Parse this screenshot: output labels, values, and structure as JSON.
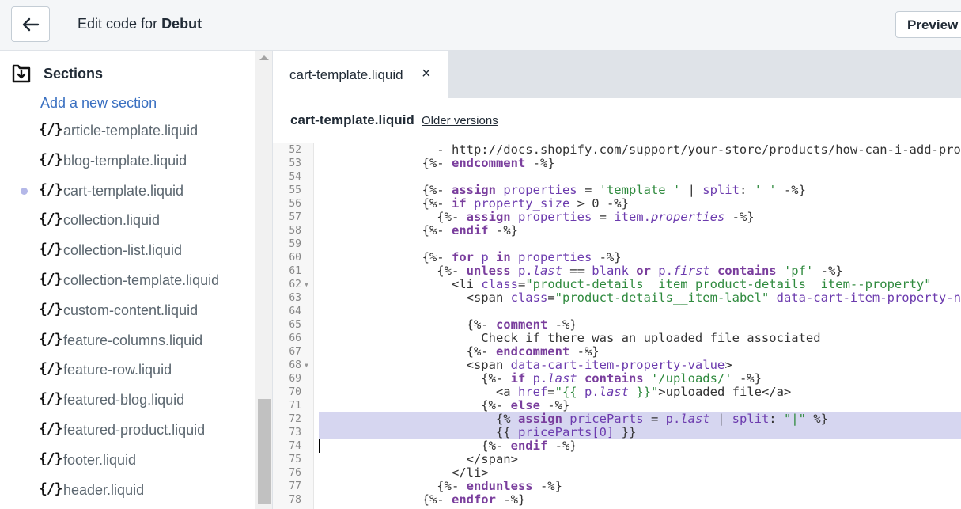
{
  "header": {
    "title_prefix": "Edit code for ",
    "theme_name": "Debut",
    "preview_label": "Preview"
  },
  "sidebar": {
    "section_title": "Sections",
    "add_link": "Add a new section",
    "active_index": 2,
    "files": [
      "article-template.liquid",
      "blog-template.liquid",
      "cart-template.liquid",
      "collection.liquid",
      "collection-list.liquid",
      "collection-template.liquid",
      "custom-content.liquid",
      "feature-columns.liquid",
      "feature-row.liquid",
      "featured-blog.liquid",
      "featured-product.liquid",
      "footer.liquid",
      "header.liquid"
    ],
    "file_icon_text": "{/}"
  },
  "editor": {
    "tab_label": "cart-template.liquid",
    "tab_close": "×",
    "file_name": "cart-template.liquid",
    "older_versions": "Older versions",
    "highlight_lines": [
      72,
      73
    ],
    "cursor_line": 74,
    "lines": [
      {
        "n": 52,
        "fold": false,
        "tokens": [
          [
            "p",
            "                - http://docs.shopify.com/support/your-store/products/how-can-i-add-product-options"
          ]
        ]
      },
      {
        "n": 53,
        "fold": false,
        "tokens": [
          [
            "p",
            "              {%- "
          ],
          [
            "k",
            "endcomment"
          ],
          [
            "p",
            " -%}"
          ]
        ]
      },
      {
        "n": 54,
        "fold": false,
        "tokens": [
          [
            "p",
            ""
          ]
        ]
      },
      {
        "n": 55,
        "fold": false,
        "tokens": [
          [
            "p",
            "              {%- "
          ],
          [
            "k",
            "assign"
          ],
          [
            "i",
            " properties"
          ],
          [
            "p",
            " = "
          ],
          [
            "s",
            "'template '"
          ],
          [
            "p",
            " | "
          ],
          [
            "i",
            "split"
          ],
          [
            "p",
            ": "
          ],
          [
            "s",
            "' '"
          ],
          [
            "p",
            " -%}"
          ]
        ]
      },
      {
        "n": 56,
        "fold": false,
        "tokens": [
          [
            "p",
            "              {%- "
          ],
          [
            "k",
            "if"
          ],
          [
            "i",
            " property_size"
          ],
          [
            "p",
            " > 0 -%}"
          ]
        ]
      },
      {
        "n": 57,
        "fold": false,
        "tokens": [
          [
            "p",
            "                {%- "
          ],
          [
            "k",
            "assign"
          ],
          [
            "i",
            " properties"
          ],
          [
            "p",
            " = "
          ],
          [
            "i",
            "item."
          ],
          [
            "e",
            "properties"
          ],
          [
            "p",
            " -%}"
          ]
        ]
      },
      {
        "n": 58,
        "fold": false,
        "tokens": [
          [
            "p",
            "              {%- "
          ],
          [
            "k",
            "endif"
          ],
          [
            "p",
            " -%}"
          ]
        ]
      },
      {
        "n": 59,
        "fold": false,
        "tokens": [
          [
            "p",
            ""
          ]
        ]
      },
      {
        "n": 60,
        "fold": false,
        "tokens": [
          [
            "p",
            "              {%- "
          ],
          [
            "k",
            "for"
          ],
          [
            "i",
            " p"
          ],
          [
            "k",
            " in"
          ],
          [
            "i",
            " properties"
          ],
          [
            "p",
            " -%}"
          ]
        ]
      },
      {
        "n": 61,
        "fold": false,
        "tokens": [
          [
            "p",
            "                {%- "
          ],
          [
            "k",
            "unless"
          ],
          [
            "i",
            " p."
          ],
          [
            "e",
            "last"
          ],
          [
            "p",
            " == "
          ],
          [
            "i",
            "blank"
          ],
          [
            "k",
            " or"
          ],
          [
            "i",
            " p."
          ],
          [
            "e",
            "first"
          ],
          [
            "k",
            " contains"
          ],
          [
            "s",
            " 'pf'"
          ],
          [
            "p",
            " -%}"
          ]
        ]
      },
      {
        "n": 62,
        "fold": true,
        "tokens": [
          [
            "p",
            "                  <li "
          ],
          [
            "i",
            "class"
          ],
          [
            "p",
            "="
          ],
          [
            "s",
            "\"product-details__item product-details__item--property\""
          ]
        ]
      },
      {
        "n": 63,
        "fold": false,
        "tokens": [
          [
            "p",
            "                    <span "
          ],
          [
            "i",
            "class"
          ],
          [
            "p",
            "="
          ],
          [
            "s",
            "\"product-details__item-label\""
          ],
          [
            "i",
            " data-cart-item-property-name"
          ]
        ]
      },
      {
        "n": 64,
        "fold": false,
        "tokens": [
          [
            "p",
            ""
          ]
        ]
      },
      {
        "n": 65,
        "fold": false,
        "tokens": [
          [
            "p",
            "                    {%- "
          ],
          [
            "k",
            "comment"
          ],
          [
            "p",
            " -%}"
          ]
        ]
      },
      {
        "n": 66,
        "fold": false,
        "tokens": [
          [
            "p",
            "                      Check if there was an uploaded file associated"
          ]
        ]
      },
      {
        "n": 67,
        "fold": false,
        "tokens": [
          [
            "p",
            "                    {%- "
          ],
          [
            "k",
            "endcomment"
          ],
          [
            "p",
            " -%}"
          ]
        ]
      },
      {
        "n": 68,
        "fold": true,
        "tokens": [
          [
            "p",
            "                    <span "
          ],
          [
            "i",
            "data-cart-item-property-value"
          ],
          [
            "p",
            ">"
          ]
        ]
      },
      {
        "n": 69,
        "fold": false,
        "tokens": [
          [
            "p",
            "                      {%- "
          ],
          [
            "k",
            "if"
          ],
          [
            "i",
            " p."
          ],
          [
            "e",
            "last"
          ],
          [
            "k",
            " contains"
          ],
          [
            "s",
            " '/uploads/'"
          ],
          [
            "p",
            " -%}"
          ]
        ]
      },
      {
        "n": 70,
        "fold": false,
        "tokens": [
          [
            "p",
            "                        <a "
          ],
          [
            "i",
            "href"
          ],
          [
            "p",
            "="
          ],
          [
            "s",
            "\"{{ "
          ],
          [
            "i",
            "p."
          ],
          [
            "e",
            "last"
          ],
          [
            "s",
            " }}\""
          ],
          [
            "p",
            ">uploaded file</a>"
          ]
        ]
      },
      {
        "n": 71,
        "fold": false,
        "tokens": [
          [
            "p",
            "                      {%- "
          ],
          [
            "k",
            "else"
          ],
          [
            "p",
            " -%}"
          ]
        ]
      },
      {
        "n": 72,
        "fold": false,
        "tokens": [
          [
            "p",
            "                        {% "
          ],
          [
            "k",
            "assign"
          ],
          [
            "i",
            " priceParts"
          ],
          [
            "p",
            " = "
          ],
          [
            "i",
            "p."
          ],
          [
            "e",
            "last"
          ],
          [
            "p",
            " | "
          ],
          [
            "i",
            "split"
          ],
          [
            "p",
            ": "
          ],
          [
            "s",
            "\"|\""
          ],
          [
            "p",
            " %}"
          ]
        ]
      },
      {
        "n": 73,
        "fold": false,
        "tokens": [
          [
            "p",
            "                        {{ "
          ],
          [
            "i",
            "priceParts[0]"
          ],
          [
            "p",
            " }}"
          ]
        ]
      },
      {
        "n": 74,
        "fold": false,
        "tokens": [
          [
            "p",
            "                      {%- "
          ],
          [
            "k",
            "endif"
          ],
          [
            "p",
            " -%}"
          ]
        ]
      },
      {
        "n": 75,
        "fold": false,
        "tokens": [
          [
            "p",
            "                    </span>"
          ]
        ]
      },
      {
        "n": 76,
        "fold": false,
        "tokens": [
          [
            "p",
            "                  </li>"
          ]
        ]
      },
      {
        "n": 77,
        "fold": false,
        "tokens": [
          [
            "p",
            "                {%- "
          ],
          [
            "k",
            "endunless"
          ],
          [
            "p",
            " -%}"
          ]
        ]
      },
      {
        "n": 78,
        "fold": false,
        "tokens": [
          [
            "p",
            "              {%- "
          ],
          [
            "k",
            "endfor"
          ],
          [
            "p",
            " -%}"
          ]
        ]
      }
    ]
  }
}
